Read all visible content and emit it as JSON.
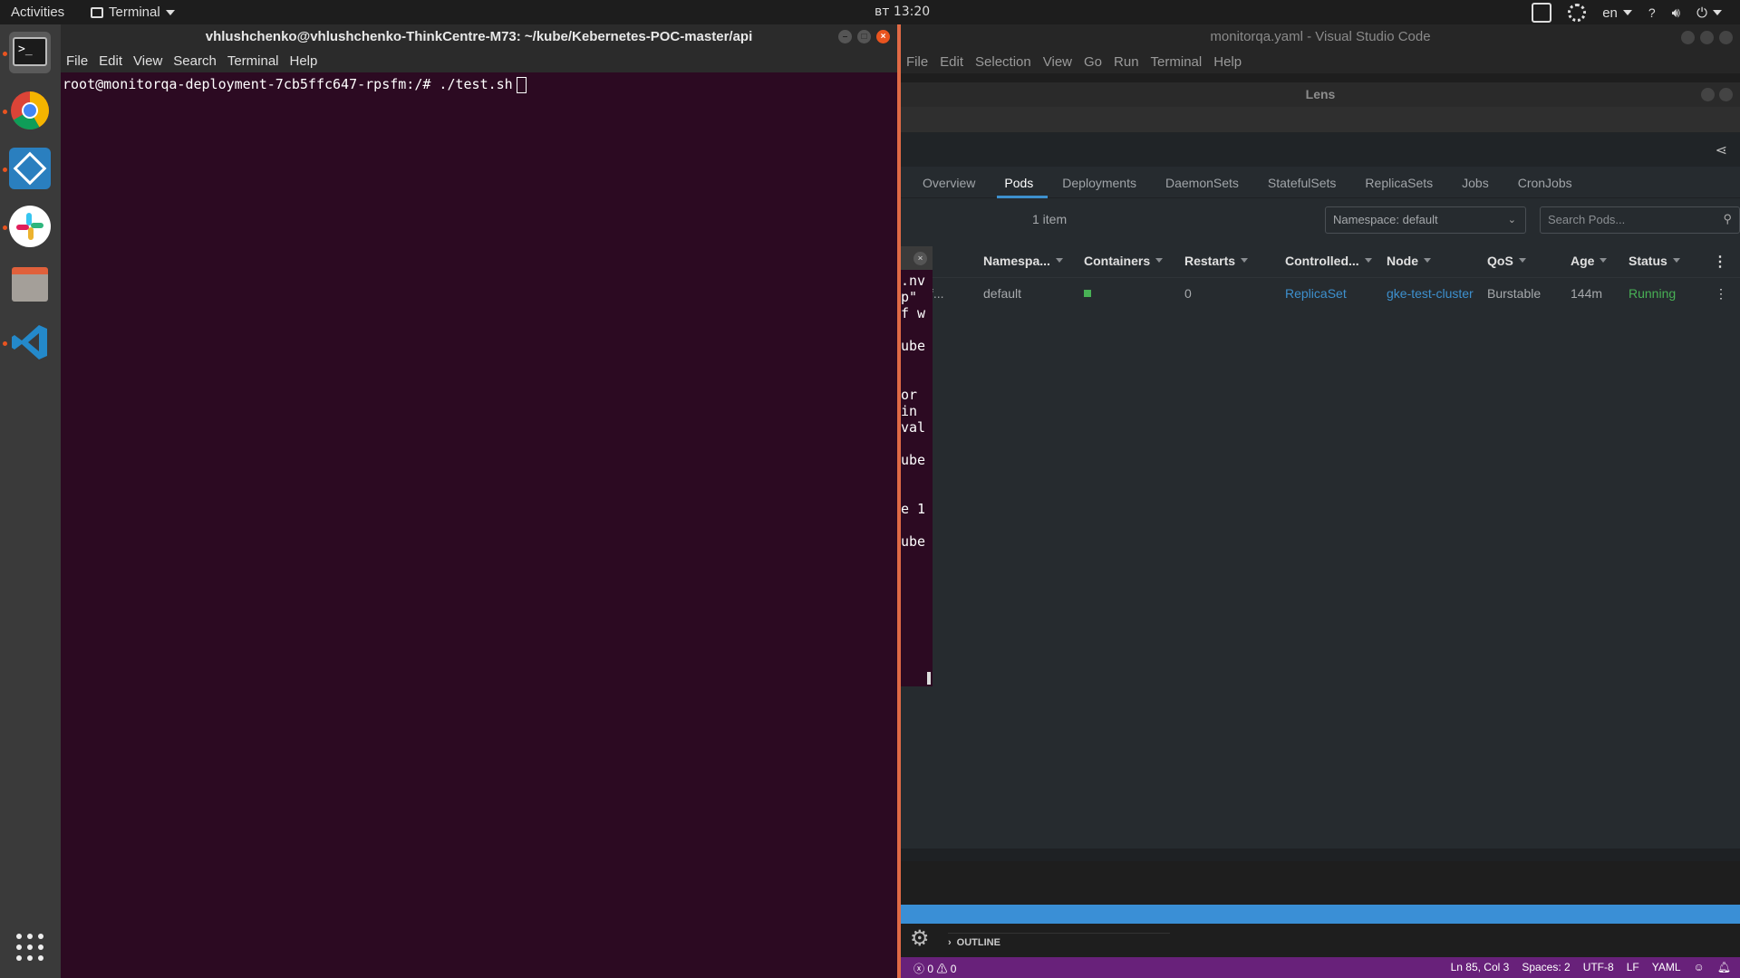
{
  "topbar": {
    "activities": "Activities",
    "app_menu": "Terminal",
    "clock": "вт 13:20",
    "lang": "en"
  },
  "dock": {
    "apps": [
      "terminal-icon",
      "chrome-icon",
      "shutter-icon",
      "slack-icon",
      "files-icon",
      "vscode-icon",
      "show-apps-icon"
    ]
  },
  "terminal": {
    "title": "vhlushchenko@vhlushchenko-ThinkCentre-M73: ~/kube/Kebernetes-POC-master/api",
    "menu": [
      "File",
      "Edit",
      "View",
      "Search",
      "Terminal",
      "Help"
    ],
    "line": "root@monitorqa-deployment-7cb5ffc647-rpsfm:/# ./test.sh"
  },
  "overlay": {
    "lines": [
      ".nv",
      "p\"",
      "f w",
      "",
      "ube",
      "",
      "",
      "or",
      "in",
      "val",
      "",
      "ube",
      "",
      "",
      "e 1",
      "",
      "ube"
    ]
  },
  "vscode": {
    "title": "monitorqa.yaml - Visual Studio Code",
    "menu": [
      "File",
      "Edit",
      "Selection",
      "View",
      "Go",
      "Run",
      "Terminal",
      "Help"
    ],
    "outline_label": "OUTLINE",
    "status": {
      "problems": "0",
      "warnings": "0",
      "position": "Ln 85, Col 3",
      "spaces": "Spaces: 2",
      "encoding": "UTF-8",
      "eol": "LF",
      "language": "YAML"
    }
  },
  "lens": {
    "title": "Lens",
    "tabs": [
      "Overview",
      "Pods",
      "Deployments",
      "DaemonSets",
      "StatefulSets",
      "ReplicaSets",
      "Jobs",
      "CronJobs"
    ],
    "active_tab": "Pods",
    "items_count": "1 item",
    "namespace_select": "Namespace: default",
    "search_placeholder": "Search Pods...",
    "columns": [
      "Namespa...",
      "Containers",
      "Restarts",
      "Controlled...",
      "Node",
      "QoS",
      "Age",
      "Status"
    ],
    "row": {
      "name_trunc": "f...",
      "namespace": "default",
      "restarts": "0",
      "controlled_by": "ReplicaSet",
      "node": "gke-test-cluster",
      "qos": "Burstable",
      "age": "144m",
      "status": "Running"
    }
  }
}
